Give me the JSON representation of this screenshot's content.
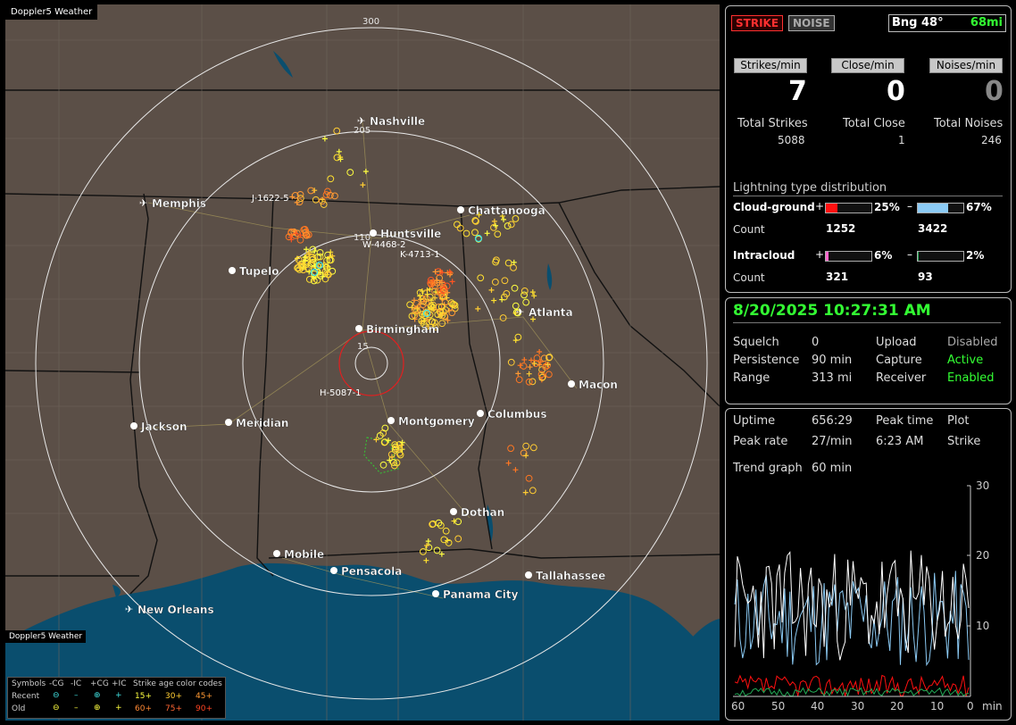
{
  "map": {
    "brand": "Doppler5 Weather",
    "watermark": "Doppler5 Weather",
    "range_labels": [
      "300",
      "205",
      "110",
      "15"
    ],
    "cities": [
      {
        "name": "Nashville",
        "airport": true
      },
      {
        "name": "Memphis",
        "airport": true
      },
      {
        "name": "Chattanooga",
        "airport": false
      },
      {
        "name": "Huntsville",
        "airport": false
      },
      {
        "name": "Tupelo",
        "airport": false
      },
      {
        "name": "Atlanta",
        "airport": true
      },
      {
        "name": "Birmingham",
        "airport": false
      },
      {
        "name": "Macon",
        "airport": false
      },
      {
        "name": "Jackson",
        "airport": false
      },
      {
        "name": "Meridian",
        "airport": false
      },
      {
        "name": "Montgomery",
        "airport": false
      },
      {
        "name": "Columbus",
        "airport": false
      },
      {
        "name": "Dothan",
        "airport": false
      },
      {
        "name": "Mobile",
        "airport": false
      },
      {
        "name": "Pensacola",
        "airport": false
      },
      {
        "name": "Tallahassee",
        "airport": false
      },
      {
        "name": "Panama City",
        "airport": false
      },
      {
        "name": "New Orleans",
        "airport": true
      }
    ],
    "storm_labels": [
      "J-1622-5",
      "W-4468-2",
      "K-4713-1",
      "H-5087-1"
    ]
  },
  "legend": {
    "symbols_label": "Symbols",
    "col_neg_cg": "-CG",
    "col_neg_ic": "-IC",
    "col_pos_cg": "+CG",
    "col_pos_ic": "+IC",
    "age_title": "Strike age color codes",
    "recent_label": "Recent",
    "old_label": "Old",
    "recent_ages": [
      "15+",
      "30+",
      "45+"
    ],
    "old_ages": [
      "60+",
      "75+",
      "90+"
    ]
  },
  "counts": {
    "strike_btn": "STRIKE",
    "noise_btn": "NOISE",
    "bearing": "Bng 48°",
    "distance": "68mi",
    "strikes_min_label": "Strikes/min",
    "close_min_label": "Close/min",
    "noises_min_label": "Noises/min",
    "strikes_min": "7",
    "close_min": "0",
    "noises_min": "0",
    "total_strikes_label": "Total Strikes",
    "total_close_label": "Total Close",
    "total_noises_label": "Total Noises",
    "total_strikes": "5088",
    "total_close": "1",
    "total_noises": "246"
  },
  "distribution": {
    "title": "Lightning type distribution",
    "cg_label": "Cloud-ground",
    "ic_label": "Intracloud",
    "count_label": "Count",
    "plus": "+",
    "minus": "–",
    "cg_pos_pct": "25%",
    "cg_neg_pct": "67%",
    "ic_pos_pct": "6%",
    "ic_neg_pct": "2%",
    "cg_pos_frac": 0.25,
    "cg_neg_frac": 0.67,
    "ic_pos_frac": 0.06,
    "ic_neg_frac": 0.02,
    "cg_pos_count": "1252",
    "cg_neg_count": "3422",
    "ic_pos_count": "321",
    "ic_neg_count": "93"
  },
  "status": {
    "datetime": "8/20/2025 10:27:31 AM",
    "squelch_label": "Squelch",
    "squelch": "0",
    "persistence_label": "Persistence",
    "persistence": "90 min",
    "range_label": "Range",
    "range": "313 mi",
    "upload_label": "Upload",
    "upload": "Disabled",
    "capture_label": "Capture",
    "capture": "Active",
    "receiver_label": "Receiver",
    "receiver": "Enabled"
  },
  "stats": {
    "uptime_label": "Uptime",
    "uptime": "656:29",
    "peak_time_label": "Peak time",
    "peak_time": "6:23 AM",
    "plot_label": "Plot",
    "plot": "Strike",
    "peak_rate_label": "Peak rate",
    "peak_rate": "27/min",
    "trend_label": "Trend graph",
    "trend": "60 min",
    "y_ticks": [
      "30",
      "20",
      "10"
    ],
    "x_ticks": [
      "60",
      "50",
      "40",
      "30",
      "20",
      "10",
      "0"
    ],
    "x_unit": "min"
  },
  "colors": {
    "land": "#5b4f47",
    "water": "#0a4e6e",
    "strike_red": "#ff3030",
    "active_green": "#33ff33",
    "cg_pos_bar": "#ff1010",
    "cg_neg_bar": "#8ccbf5",
    "ic_pos_bar": "#ff66cc",
    "ic_neg_bar": "#22aa55"
  }
}
